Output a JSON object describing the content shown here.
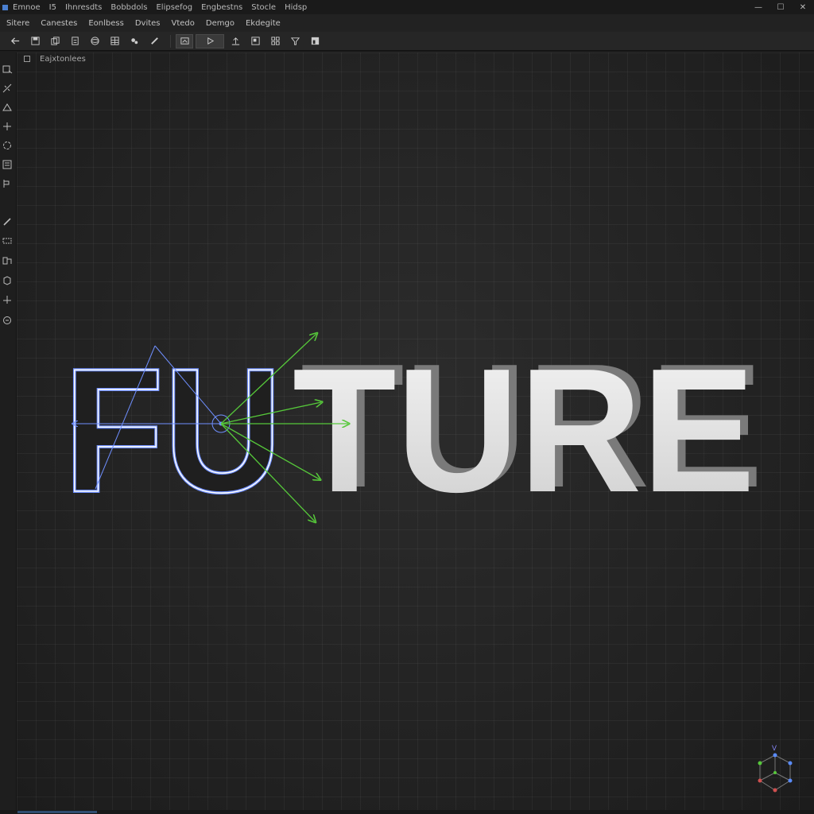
{
  "title_menu": [
    "Emnoe",
    "I5",
    "Ihnresdts",
    "Bobbdols",
    "Elipsefog",
    "Engbestns",
    "Stocle",
    "Hidsp"
  ],
  "menubar": [
    "Sitere",
    "Canestes",
    "Eonlbess",
    "Dvites",
    "Vtedo",
    "Demgo",
    "Ekdegite"
  ],
  "viewport": {
    "label": "Eajxtonlees"
  },
  "scene": {
    "word_outline": "FU",
    "word_solid": "TURE"
  },
  "gizmo": {
    "axis_label": "V"
  },
  "colors": {
    "wireframe": "#6f8fff",
    "arrows": "#56c83a",
    "solid_text": "#e8e8e8",
    "accent": "#4a7fd0"
  },
  "icons": {
    "toolbar": [
      "back-arrow-icon",
      "save-icon",
      "copy-icon",
      "clipboard-icon",
      "sphere-icon",
      "table-icon",
      "brush-icon",
      "pen-icon",
      "frame-icon",
      "play-icon",
      "upload-icon",
      "layout-icon",
      "grid-icon",
      "filter-icon",
      "panel-icon"
    ],
    "left_tools": [
      "select-icon",
      "transform-icon",
      "move-icon",
      "add-icon",
      "rotate-icon",
      "scale-icon",
      "mesh-icon",
      "edit-icon",
      "draw-icon",
      "measure-icon",
      "box-icon",
      "camera-icon",
      "anchor-icon",
      "settings-icon"
    ]
  }
}
